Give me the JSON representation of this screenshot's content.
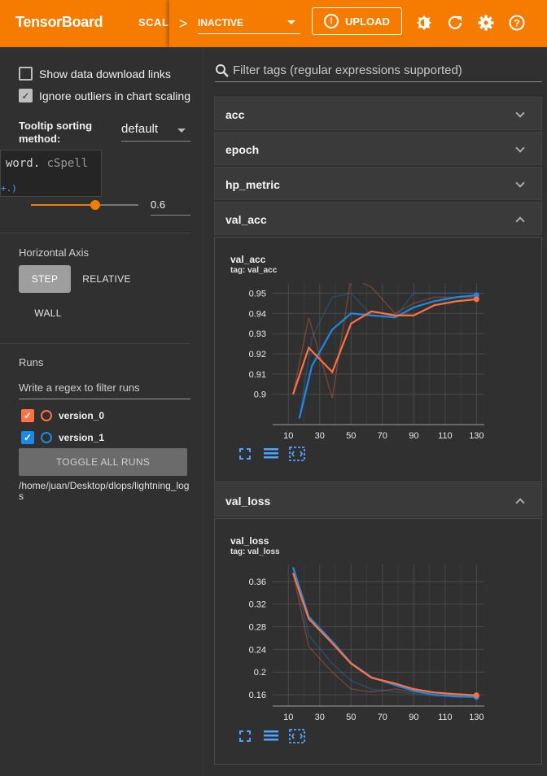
{
  "topbar": {
    "brand": "TensorBoard",
    "tab_label": "SCALARS",
    "tab_arrow": ">",
    "inactive_label": "INACTIVE",
    "upload_label": "UPLOAD"
  },
  "sidebar": {
    "show_download_links": "Show data download links",
    "ignore_outliers": "Ignore outliers in chart scaling",
    "tooltip_sorting_label": "Tooltip sorting method:",
    "tooltip_sorting_value": "default",
    "popup_code_word": "word.",
    "popup_code_spell": "cSpell",
    "popup_sub": "+.)",
    "smoothing_value": "0.6",
    "smoothing_fraction": 0.6,
    "horizontal_axis_title": "Horizontal Axis",
    "axis_step": "STEP",
    "axis_relative": "RELATIVE",
    "axis_wall": "WALL",
    "runs_title": "Runs",
    "runs_filter_placeholder": "Write a regex to filter runs",
    "runs": [
      {
        "name": "version_0",
        "color": "#ff7043"
      },
      {
        "name": "version_1",
        "color": "#1e88e5"
      }
    ],
    "toggle_all": "TOGGLE ALL RUNS",
    "logdir": "/home/juan/Desktop/dlops/lightning_logs"
  },
  "main": {
    "filter_placeholder": "Filter tags (regular expressions supported)",
    "cards": {
      "acc": "acc",
      "epoch": "epoch",
      "hp_metric": "hp_metric",
      "val_acc": "val_acc",
      "val_loss": "val_loss"
    },
    "val_acc_chart": {
      "title": "val_acc",
      "tag": "tag: val_acc"
    },
    "val_loss_chart": {
      "title": "val_loss",
      "tag": "tag: val_loss"
    }
  },
  "chart_data": [
    {
      "type": "line",
      "title": "val_acc",
      "subtitle": "tag: val_acc",
      "xlim": [
        0,
        135
      ],
      "ylim": [
        0.885,
        0.955
      ],
      "xticks": [
        10,
        30,
        50,
        70,
        90,
        110,
        130
      ],
      "yticks": [
        0.9,
        0.91,
        0.92,
        0.93,
        0.94,
        0.95
      ],
      "series": [
        {
          "name": "version_0",
          "color": "#ff7043",
          "x": [
            13,
            23,
            38,
            50,
            63,
            78,
            90,
            103,
            117,
            130
          ],
          "y": [
            0.9,
            0.923,
            0.911,
            0.935,
            0.941,
            0.939,
            0.939,
            0.944,
            0.946,
            0.947
          ]
        },
        {
          "name": "version_1",
          "color": "#1e88e5",
          "x": [
            17,
            25,
            38,
            50,
            63,
            78,
            90,
            103,
            117,
            130
          ],
          "y": [
            0.888,
            0.914,
            0.932,
            0.94,
            0.939,
            0.938,
            0.943,
            0.946,
            0.948,
            0.949
          ]
        }
      ],
      "raw_series": [
        {
          "color": "#ff7043",
          "x": [
            13,
            23,
            38,
            50,
            63,
            78,
            90,
            103,
            117,
            130
          ],
          "y": [
            0.9,
            0.938,
            0.898,
            0.958,
            0.953,
            0.94,
            0.945,
            0.948,
            0.948,
            0.948
          ]
        },
        {
          "color": "#1e88e5",
          "x": [
            17,
            25,
            38,
            50,
            63,
            78,
            90,
            103,
            117,
            130
          ],
          "y": [
            0.888,
            0.928,
            0.948,
            0.95,
            0.939,
            0.938,
            0.95,
            0.95,
            0.95,
            0.95
          ]
        }
      ],
      "grid": true
    },
    {
      "type": "line",
      "title": "val_loss",
      "subtitle": "tag: val_loss",
      "xlim": [
        0,
        135
      ],
      "ylim": [
        0.14,
        0.39
      ],
      "xticks": [
        10,
        30,
        50,
        70,
        90,
        110,
        130
      ],
      "yticks": [
        0.16,
        0.2,
        0.24,
        0.28,
        0.32,
        0.36
      ],
      "series": [
        {
          "name": "version_0",
          "color": "#ff7043",
          "x": [
            13,
            23,
            38,
            50,
            63,
            78,
            90,
            103,
            117,
            130
          ],
          "y": [
            0.375,
            0.294,
            0.251,
            0.215,
            0.19,
            0.18,
            0.17,
            0.164,
            0.161,
            0.159
          ]
        },
        {
          "name": "version_1",
          "color": "#1e88e5",
          "x": [
            13,
            23,
            38,
            50,
            63,
            78,
            90,
            103,
            117,
            130
          ],
          "y": [
            0.385,
            0.298,
            0.254,
            0.216,
            0.191,
            0.177,
            0.167,
            0.16,
            0.157,
            0.156
          ]
        }
      ],
      "raw_series": [
        {
          "color": "#ff7043",
          "x": [
            13,
            23,
            38,
            50,
            63,
            78,
            90,
            103,
            117,
            130
          ],
          "y": [
            0.375,
            0.245,
            0.2,
            0.17,
            0.165,
            0.17,
            0.165,
            0.16,
            0.159,
            0.159
          ]
        },
        {
          "color": "#1e88e5",
          "x": [
            13,
            23,
            38,
            50,
            63,
            78,
            90,
            103,
            117,
            130
          ],
          "y": [
            0.385,
            0.265,
            0.215,
            0.185,
            0.17,
            0.165,
            0.162,
            0.158,
            0.156,
            0.156
          ]
        }
      ],
      "grid": true
    }
  ]
}
